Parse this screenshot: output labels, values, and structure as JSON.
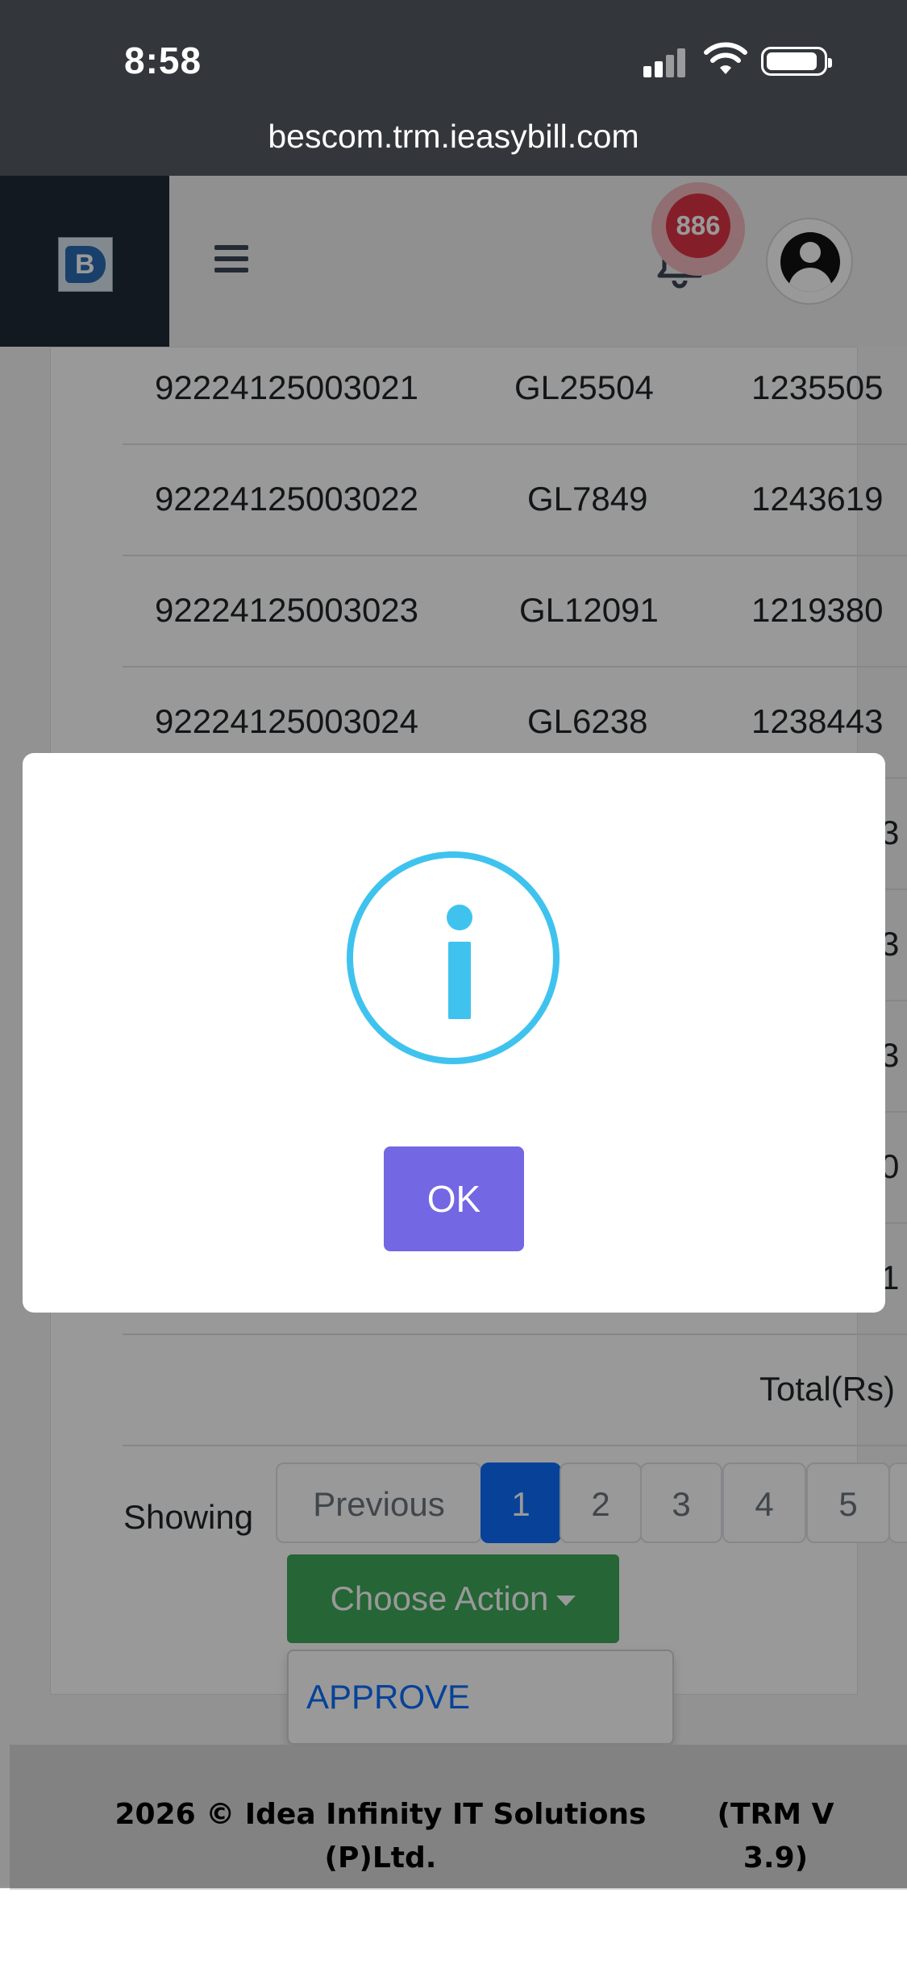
{
  "status_bar": {
    "time": "8:58",
    "url": "bescom.trm.ieasybill.com"
  },
  "header": {
    "notification_count": "886"
  },
  "table": {
    "rows": [
      [
        "92224125003021",
        "GL25504",
        "1235505"
      ],
      [
        "92224125003022",
        "GL7849",
        "1243619"
      ],
      [
        "92224125003023",
        "GL12091",
        "1219380"
      ],
      [
        "92224125003024",
        "GL6238",
        "1238443"
      ],
      [
        "",
        "",
        "3"
      ],
      [
        "",
        "",
        "3"
      ],
      [
        "",
        "",
        "3"
      ],
      [
        "",
        "",
        "0"
      ],
      [
        "",
        "",
        "1"
      ]
    ],
    "total_label": "Total(Rs)"
  },
  "pagination": {
    "showing_label": "Showing",
    "previous": "Previous",
    "pages": [
      "1",
      "2",
      "3",
      "4",
      "5"
    ],
    "active_page": "1"
  },
  "actions": {
    "button_label": "Choose Action",
    "dropdown_items": [
      "APPROVE"
    ]
  },
  "footer": {
    "left": "2026 © Idea Infinity IT Solutions (P)Ltd.",
    "right": "(TRM V 3.9)"
  },
  "modal": {
    "icon": "info-icon",
    "ok_label": "OK"
  },
  "colors": {
    "status_bar": "#33363b",
    "primary": "#0d6efd",
    "success": "#3ea95a",
    "modal_button": "#7367e4",
    "info": "#3fc3ee",
    "badge": "#dc3545"
  }
}
